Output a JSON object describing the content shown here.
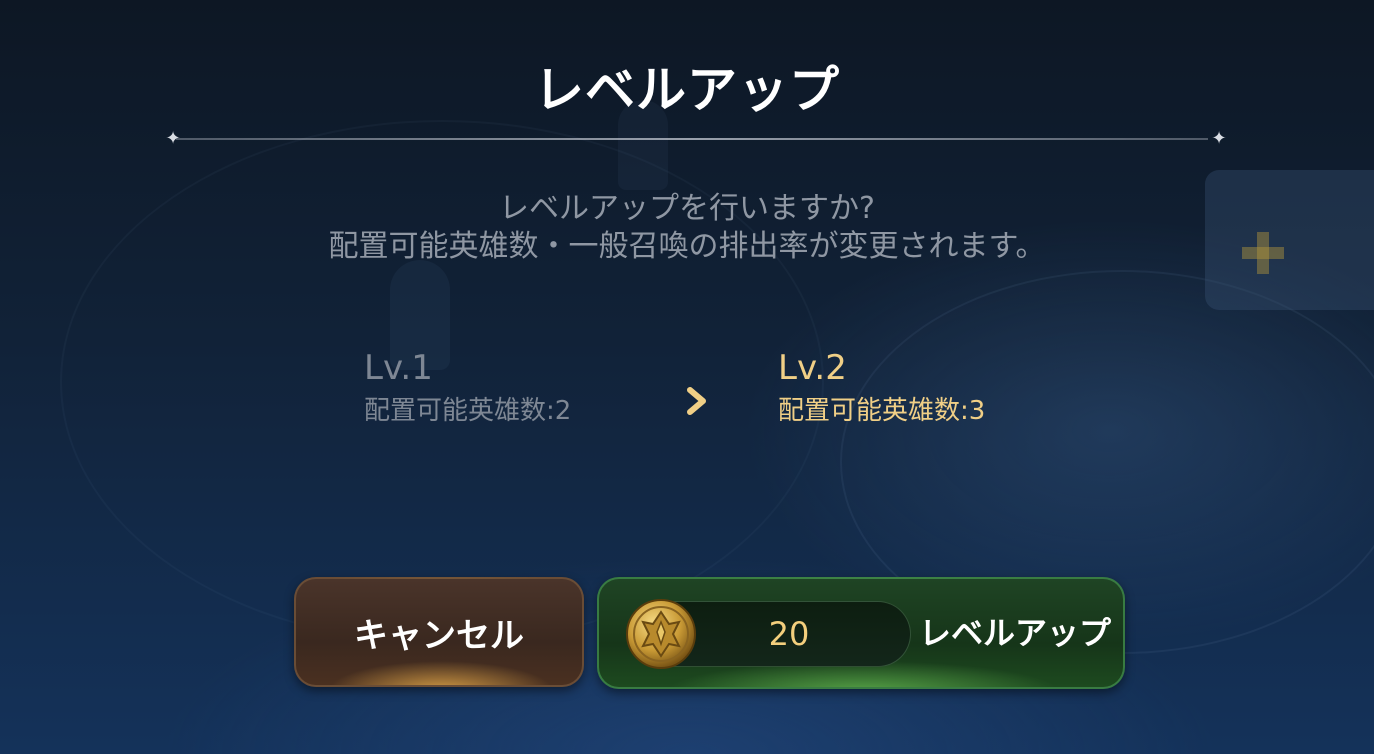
{
  "dialog": {
    "title": "レベルアップ",
    "message_line1": "レベルアップを行いますか?",
    "message_line2": "配置可能英雄数・一般召喚の排出率が変更されます。"
  },
  "current_level": {
    "label": "Lv.1",
    "stat": "配置可能英雄数:2"
  },
  "next_level": {
    "label": "Lv.2",
    "stat": "配置可能英雄数:3"
  },
  "buttons": {
    "cancel_label": "キャンセル",
    "levelup_label": "レベルアップ",
    "levelup_cost": "20"
  },
  "icons": {
    "arrow": "chevron-right-icon",
    "currency": "gold-coin-icon",
    "divider_ornament": "sparkle-star-icon"
  },
  "colors": {
    "next_level_accent": "#f0cf86",
    "cost_text": "#f3cf7d",
    "cancel_button": "#3a281f",
    "levelup_button": "#163519"
  }
}
